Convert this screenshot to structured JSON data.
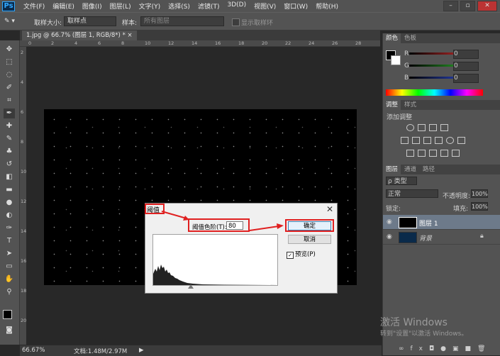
{
  "app": {
    "logo": "Ps"
  },
  "menu": [
    "文件(F)",
    "编辑(E)",
    "图像(I)",
    "图层(L)",
    "文字(Y)",
    "选择(S)",
    "滤镜(T)",
    "3D(D)",
    "视图(V)",
    "窗口(W)",
    "帮助(H)"
  ],
  "window_controls": [
    "–",
    "▫",
    "✕"
  ],
  "options_bar": {
    "sample_size_label": "取样大小:",
    "sample_size_value": "取样点",
    "sample_label": "样本:",
    "sample_value": "所有图层",
    "show_ring_label": "显示取样环"
  },
  "document": {
    "tab_title": "1.jpg @ 66.7% (图层 1, RGB/8*) *",
    "tab_close": "×",
    "ruler_h": [
      "0",
      "2",
      "4",
      "6",
      "8",
      "10",
      "12",
      "14",
      "16",
      "18",
      "20",
      "22",
      "24",
      "26",
      "28"
    ],
    "ruler_v": [
      "2",
      "4",
      "6",
      "8",
      "10",
      "12",
      "14",
      "16",
      "18",
      "20"
    ]
  },
  "status": {
    "zoom": "66.67%",
    "doc": "文档:1.48M/2.97M"
  },
  "color_panel": {
    "tabs": [
      "颜色",
      "色板"
    ],
    "labels": [
      "R",
      "G",
      "B"
    ],
    "values": [
      "0",
      "0",
      "0"
    ],
    "colors": {
      "r": "#e03030",
      "g": "#30c030",
      "b": "#3050e0"
    }
  },
  "adjust_panel": {
    "tabs": [
      "调整",
      "样式"
    ],
    "add_label": "添加调整",
    "icons": [
      "brightness-icon",
      "levels-icon",
      "curves-icon",
      "exposure-icon",
      "vibrance-icon",
      "hue-sat-icon",
      "color-balance-icon",
      "bw-icon",
      "photo-filter-icon",
      "channel-mixer-icon",
      "color-lookup-icon",
      "invert-icon",
      "posterize-icon",
      "threshold-icon",
      "gradient-map-icon",
      "selective-color-icon"
    ]
  },
  "layers_panel": {
    "tabs": [
      "图层",
      "通道",
      "路径"
    ],
    "kind_label": "ρ 类型",
    "blend_mode": "正常",
    "opacity_label": "不透明度:",
    "opacity_value": "100%",
    "lock_label": "锁定:",
    "fill_label": "填充:",
    "fill_value": "100%",
    "layers": [
      {
        "name": "图层 1",
        "selected": true
      },
      {
        "name": "背景",
        "selected": false
      }
    ]
  },
  "dialog": {
    "title": "阈值",
    "close": "✕",
    "threshold_label": "阈值色阶(T):",
    "threshold_value": "80",
    "ok": "确定",
    "cancel": "取消",
    "preview_label": "预览(P)",
    "preview_checked": true
  },
  "watermark": {
    "line1": "激活 Windows",
    "line2": "转到\"设置\"以激活 Windows。"
  }
}
